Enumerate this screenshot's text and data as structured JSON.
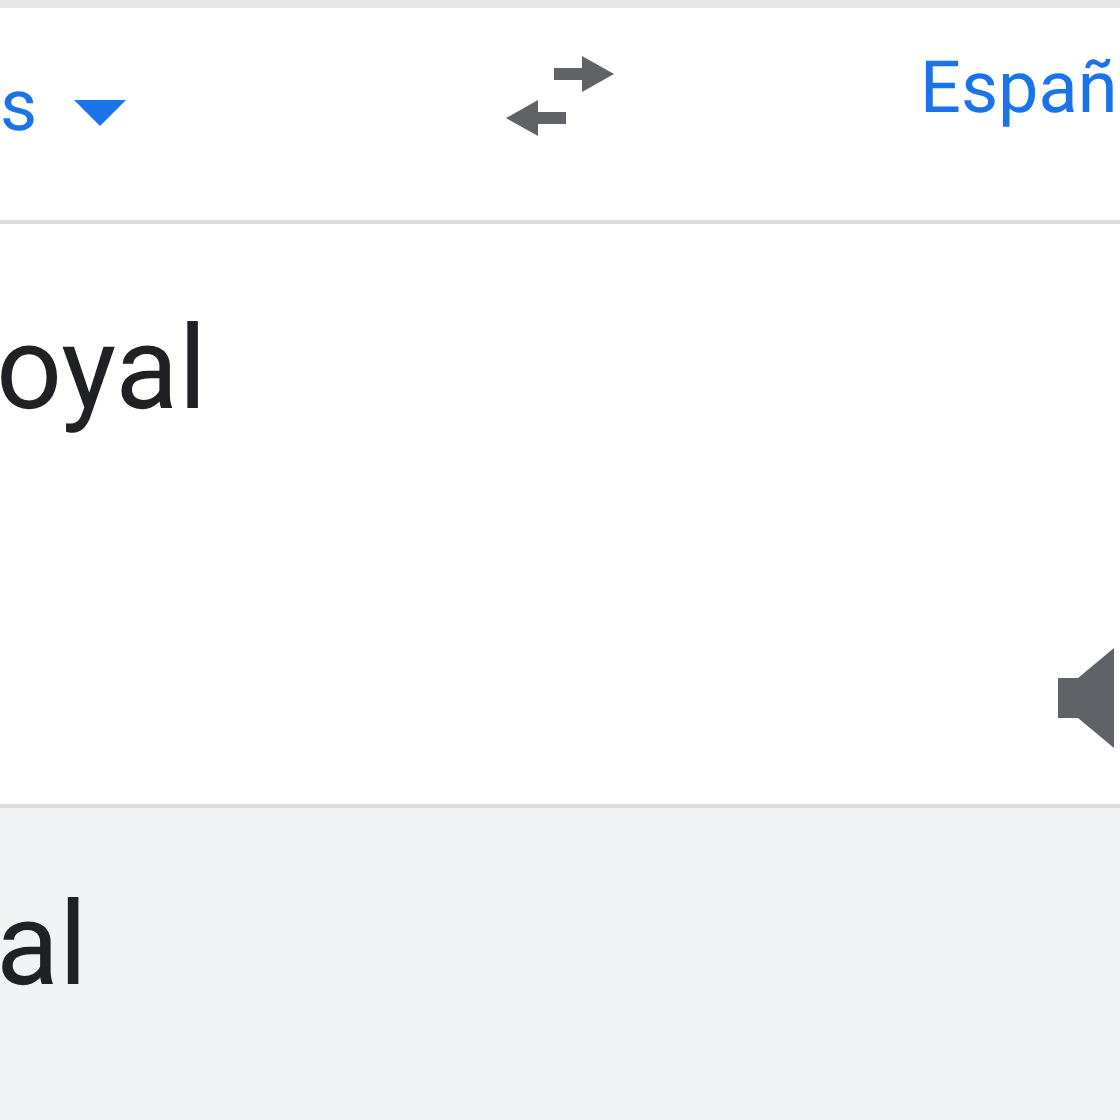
{
  "language_bar": {
    "source_language": "s",
    "target_language": "Españ"
  },
  "input": {
    "text": "oyal"
  },
  "output": {
    "text": "al"
  }
}
